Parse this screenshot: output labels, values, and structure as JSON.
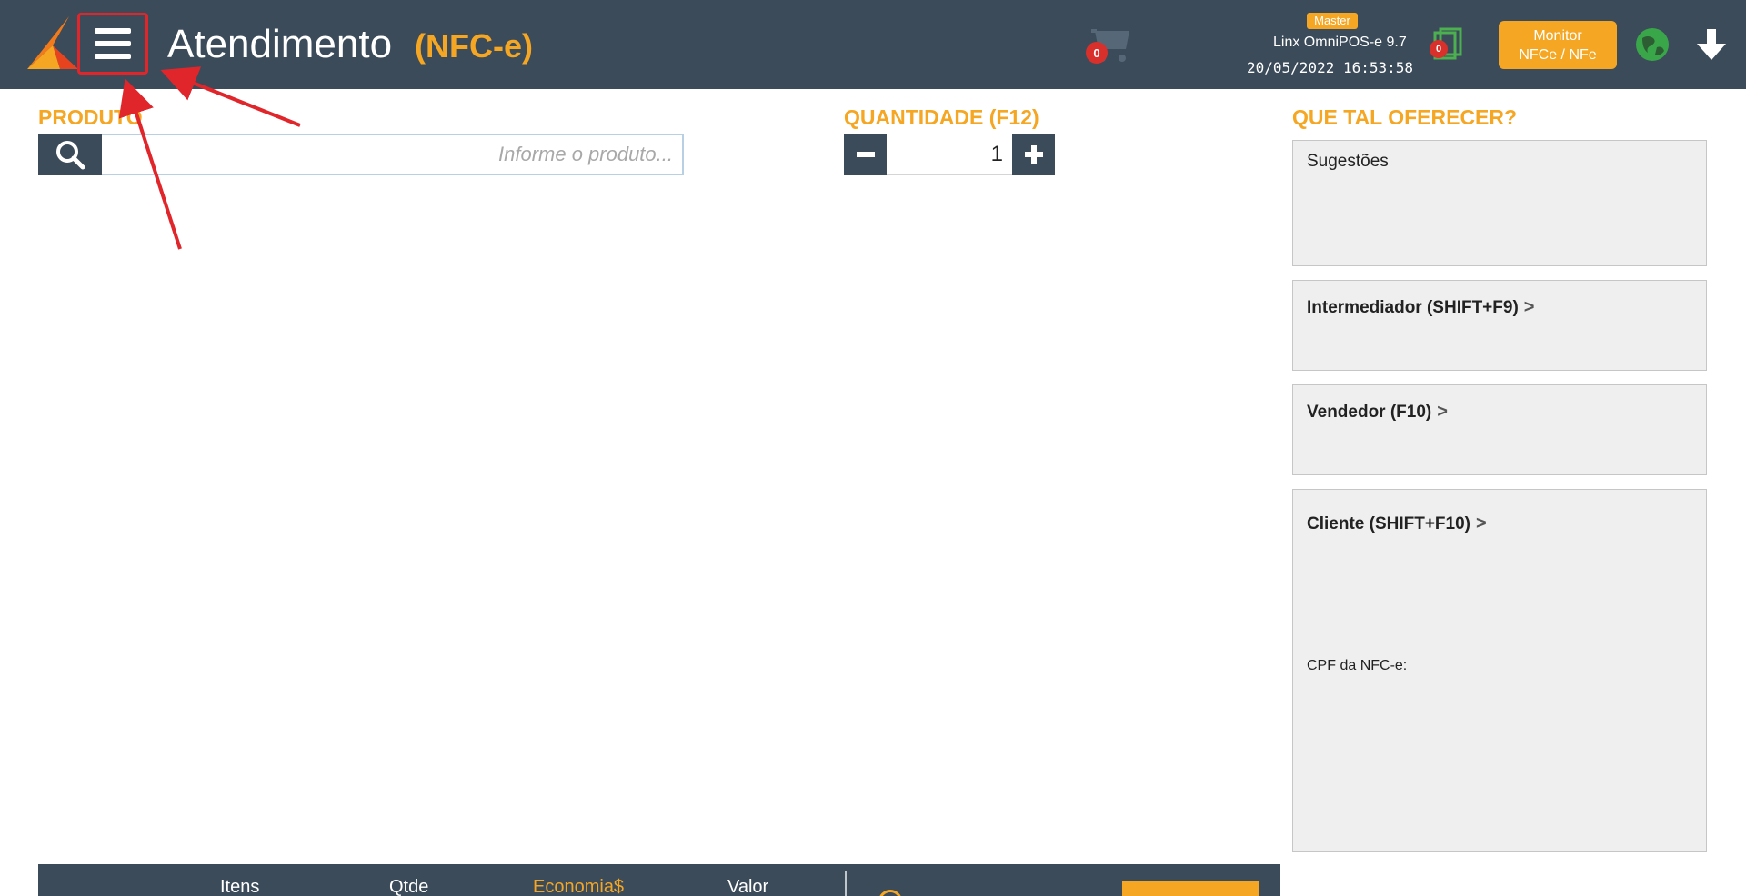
{
  "header": {
    "title": "Atendimento",
    "subtitle": "(NFC-e)",
    "cart_count": "0",
    "doc_count": "0",
    "master_label": "Master",
    "app_version": "Linx OmniPOS-e  9.7",
    "datetime": "20/05/2022 16:53:58",
    "monitor_line1": "Monitor",
    "monitor_line2": "NFCe / NFe"
  },
  "product": {
    "label": "PRODUTO",
    "placeholder": "Informe o produto..."
  },
  "quantity": {
    "label": "QUANTIDADE (F12)",
    "value": "1"
  },
  "offer": {
    "label": "QUE TAL OFERECER?",
    "suggestions_title": "Sugestões",
    "intermediary": "Intermediador (SHIFT+F9)",
    "seller": "Vendedor (F10)",
    "client": "Cliente (SHIFT+F10)",
    "cpf_label": "CPF da NFC-e:",
    "chevron": ">"
  },
  "summary": {
    "items_label": "Itens",
    "qty_label": "Qtde",
    "savings_label": "Economia$",
    "value_label": "Valor"
  },
  "colors": {
    "header_bg": "#3b4b5a",
    "accent": "#f5a623",
    "annotation": "#e0262b"
  }
}
